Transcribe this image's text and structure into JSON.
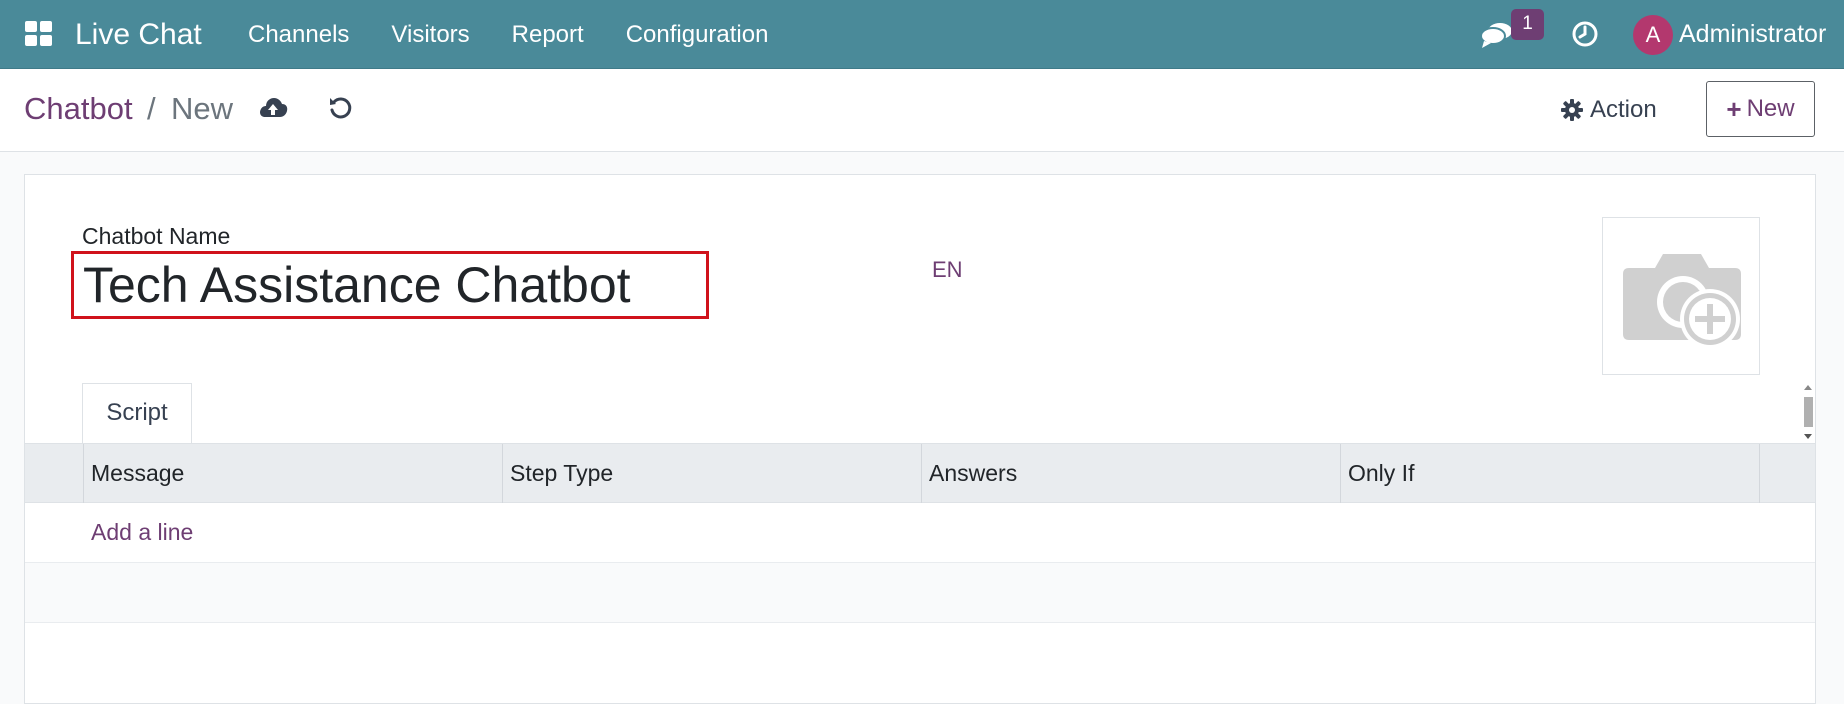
{
  "navbar": {
    "app_title": "Live Chat",
    "menu": [
      "Channels",
      "Visitors",
      "Report",
      "Configuration"
    ],
    "chat_badge": "1",
    "avatar_initial": "A",
    "user_name": "Administrator",
    "icons": [
      "apps-grid-icon",
      "chat-icon",
      "clock-icon"
    ],
    "color": "#4a8a99"
  },
  "control_panel": {
    "breadcrumb_root": "Chatbot",
    "breadcrumb_sep": "/",
    "breadcrumb_current": "New",
    "action_label": "Action",
    "new_label": "New",
    "icons": [
      "cloud-upload-icon",
      "undo-icon",
      "gear-icon",
      "plus-icon"
    ]
  },
  "form": {
    "name_label": "Chatbot Name",
    "name_value": "Tech Assistance Chatbot",
    "lang_label": "EN",
    "image_icon": "camera-plus-icon",
    "tab_script": "Script",
    "columns": [
      "Message",
      "Step Type",
      "Answers",
      "Only If"
    ],
    "add_line": "Add a line"
  },
  "colors": {
    "accent": "#6e3e73",
    "highlight_border": "#d0121b",
    "header_bg": "#e9ecef"
  }
}
